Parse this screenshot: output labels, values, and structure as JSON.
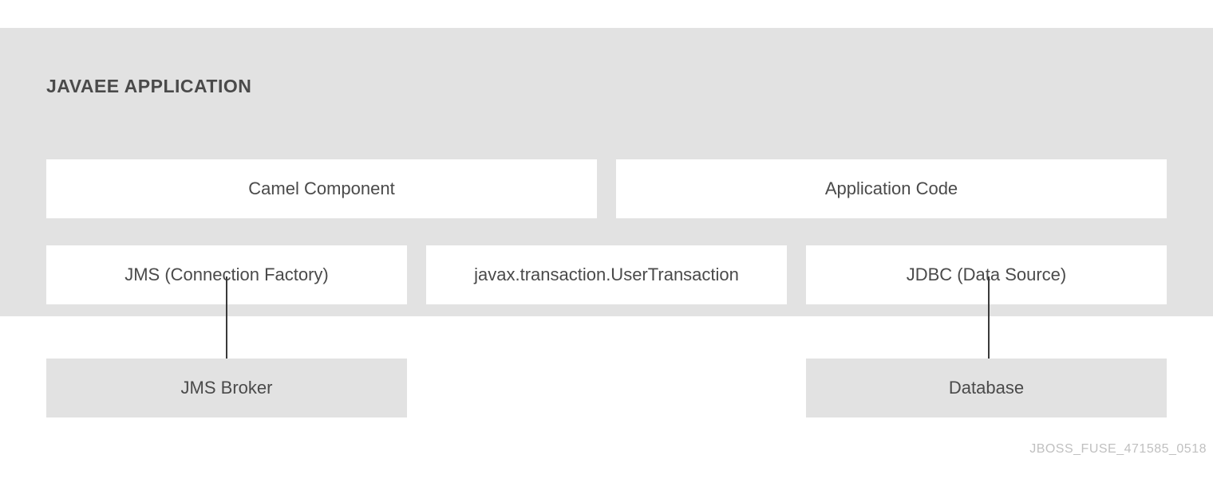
{
  "title": "JAVAEE APPLICATION",
  "row1": {
    "left": "Camel Component",
    "right": "Application Code"
  },
  "row2": {
    "left": "JMS (Connection Factory)",
    "middle": "javax.transaction.UserTransaction",
    "right": "JDBC (Data Source)"
  },
  "bottom": {
    "left": "JMS Broker",
    "right": "Database"
  },
  "caption": "JBOSS_FUSE_471585_0518"
}
